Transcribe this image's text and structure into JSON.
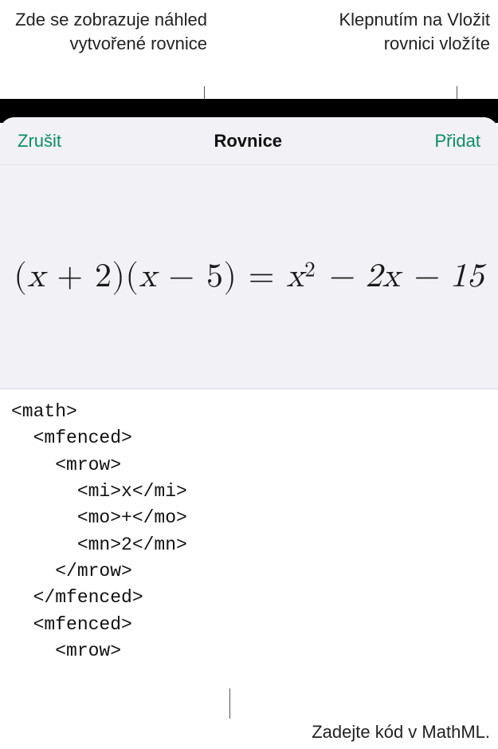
{
  "callouts": {
    "preview_hint": "Zde se zobrazuje náhled vytvořené rovnice",
    "add_hint": "Klepnutím na Vložit rovnici vložíte",
    "code_hint": "Zadejte kód v MathML."
  },
  "toolbar": {
    "cancel_label": "Zrušit",
    "title": "Rovnice",
    "add_label": "Přidat"
  },
  "equation": {
    "part1_open": "(",
    "part1_var": "x",
    "part1_op": " + ",
    "part1_num": "2",
    "part1_close": ")",
    "part2_open": "(",
    "part2_var": "x",
    "part2_op": " − ",
    "part2_num": "5",
    "part2_close": ")",
    "equals": " = ",
    "rhs_var": "x",
    "rhs_exp": "2",
    "rhs_rest": " − 2x − 15"
  },
  "mathml_code": "<math>\n  <mfenced>\n    <mrow>\n      <mi>x</mi>\n      <mo>+</mo>\n      <mn>2</mn>\n    </mrow>\n  </mfenced>\n  <mfenced>\n    <mrow>"
}
